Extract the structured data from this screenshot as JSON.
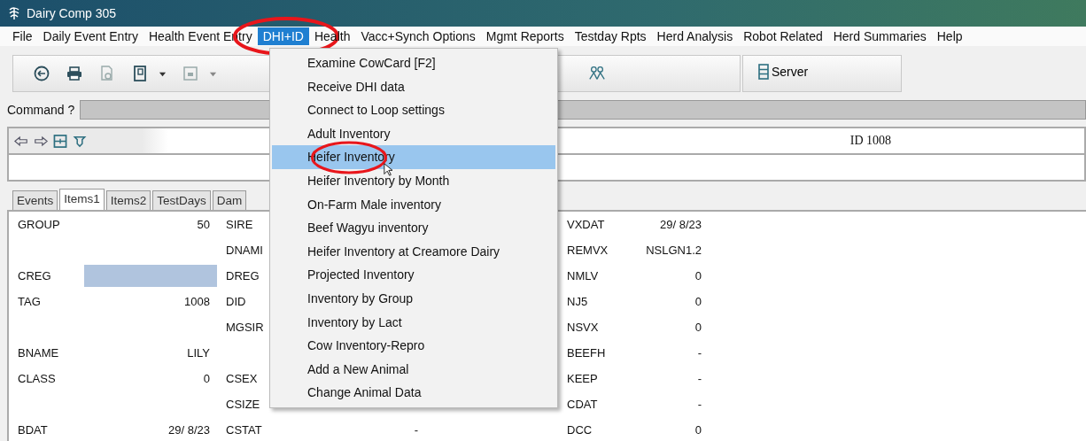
{
  "window": {
    "title": "Dairy Comp 305"
  },
  "menu_bar": [
    {
      "label": "File",
      "selected": false,
      "circled": false
    },
    {
      "label": "Daily Event Entry",
      "selected": false,
      "circled": false
    },
    {
      "label": "Health Event Entry",
      "selected": false,
      "circled": false
    },
    {
      "label": "DHI+ID",
      "selected": true,
      "circled": true
    },
    {
      "label": "Health",
      "selected": false,
      "circled": false
    },
    {
      "label": "Vacc+Synch Options",
      "selected": false,
      "circled": false
    },
    {
      "label": "Mgmt Reports",
      "selected": false,
      "circled": false
    },
    {
      "label": "Testday Rpts",
      "selected": false,
      "circled": false
    },
    {
      "label": "Herd Analysis",
      "selected": false,
      "circled": false
    },
    {
      "label": "Robot Related",
      "selected": false,
      "circled": false
    },
    {
      "label": "Herd Summaries",
      "selected": false,
      "circled": false
    },
    {
      "label": "Help",
      "selected": false,
      "circled": false
    }
  ],
  "toolbar": {
    "server_button": "Server"
  },
  "command": {
    "label": "Command ?"
  },
  "animal_header": {
    "id_text": "ID 1008"
  },
  "tabs": [
    {
      "label": "Events",
      "selected": false
    },
    {
      "label": "Items1",
      "selected": true
    },
    {
      "label": "Items2",
      "selected": false
    },
    {
      "label": "TestDays",
      "selected": false
    },
    {
      "label": "Dam",
      "selected": false
    }
  ],
  "field_rows": [
    {
      "left": {
        "label": "GROUP",
        "value": "50"
      },
      "middle": {
        "label": "SIRE"
      },
      "right": {
        "label": "VXDAT",
        "value": "29/ 8/23"
      }
    },
    {
      "middle": {
        "label": "DNAMI"
      },
      "right": {
        "label": "REMVX",
        "value": "NSLGN1.2"
      }
    },
    {
      "left": {
        "label": "CREG",
        "highlighted": true
      },
      "middle": {
        "label": "DREG"
      },
      "right": {
        "label": "NMLV",
        "value": "0"
      }
    },
    {
      "left": {
        "label": "TAG",
        "value": "1008"
      },
      "middle": {
        "label": "DID"
      },
      "right": {
        "label": "NJ5",
        "value": "0"
      }
    },
    {
      "middle": {
        "label": "MGSIR"
      },
      "right": {
        "label": "NSVX",
        "value": "0"
      }
    },
    {
      "left": {
        "label": "BNAME",
        "value": "LILY"
      },
      "right": {
        "label": "BEEFH",
        "value": "-"
      }
    },
    {
      "left": {
        "label": "CLASS",
        "value": "0"
      },
      "middle": {
        "label": "CSEX"
      },
      "right": {
        "label": "KEEP",
        "value": "-"
      }
    },
    {
      "middle": {
        "label": "CSIZE"
      },
      "right": {
        "label": "CDAT",
        "value": "-"
      }
    },
    {
      "left": {
        "label": "BDAT",
        "value": "29/ 8/23"
      },
      "middle": {
        "label": "CSTAT",
        "value": "-"
      },
      "right": {
        "label": "DCC",
        "value": "0"
      }
    }
  ],
  "dropdown_menu": {
    "items": [
      {
        "label": "Examine CowCard [F2]",
        "selected": false,
        "circled": false
      },
      {
        "label": "Receive DHI data",
        "selected": false,
        "circled": false
      },
      {
        "label": "Connect to Loop settings",
        "selected": false,
        "circled": false
      },
      {
        "label": "Adult Inventory",
        "selected": false,
        "circled": false
      },
      {
        "label": "Heifer Inventory",
        "selected": true,
        "circled": true
      },
      {
        "label": "Heifer Inventory by Month",
        "selected": false,
        "circled": false
      },
      {
        "label": "On-Farm Male inventory",
        "selected": false,
        "circled": false
      },
      {
        "label": "Beef Wagyu inventory",
        "selected": false,
        "circled": false
      },
      {
        "label": "Heifer Inventory at Creamore Dairy",
        "selected": false,
        "circled": false
      },
      {
        "label": "Projected Inventory",
        "selected": false,
        "circled": false
      },
      {
        "label": "Inventory by Group",
        "selected": false,
        "circled": false
      },
      {
        "label": "Inventory by Lact",
        "selected": false,
        "circled": false
      },
      {
        "label": "Cow Inventory-Repro",
        "selected": false,
        "circled": false
      },
      {
        "label": "Add a New Animal",
        "selected": false,
        "circled": false
      },
      {
        "label": "Change Animal Data",
        "selected": false,
        "circled": false
      }
    ]
  }
}
